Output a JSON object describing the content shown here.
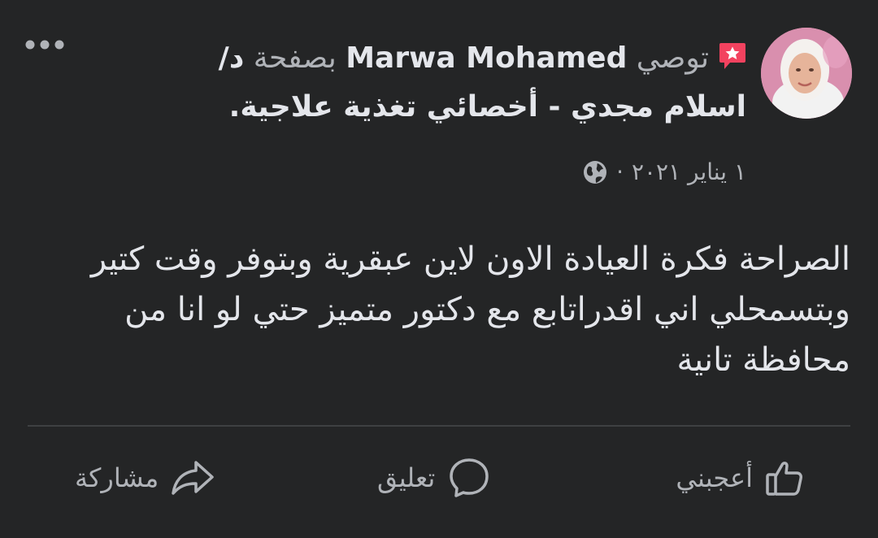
{
  "post": {
    "author": "Marwa Mohamed",
    "recommends_prefix": "توصي",
    "page_prefix": "بصفحة",
    "page_name": "د/ اسلام مجدي - أخصائي تغذية علاجية",
    "period": ".",
    "date": "١ يناير ٢٠٢١",
    "dot": "·",
    "visibility_icon": "globe-icon",
    "more_icon": "more-options-icon",
    "text": "الصراحة فكرة العيادة الاون لاين عبقرية وبتوفر وقت كتير وبتسمحلي اني اقدراتابع مع دكتور متميز حتي لو انا من محافظة تانية"
  },
  "actions": {
    "like_label": "أعجبني",
    "comment_label": "تعليق",
    "share_label": "مشاركة"
  },
  "colors": {
    "background": "#242526",
    "primary_text": "#e4e6eb",
    "secondary_text": "#b0b3b8",
    "recommend_badge": "#f3425f",
    "divider": "#3e4042"
  }
}
